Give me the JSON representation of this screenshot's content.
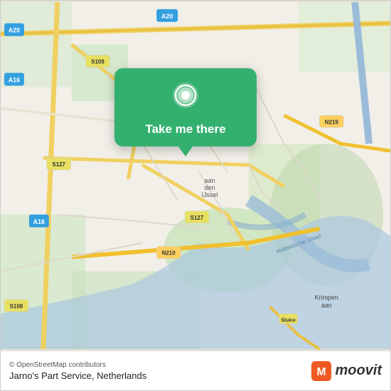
{
  "map": {
    "attribution": "© OpenStreetMap contributors",
    "location_name": "Jarno's Part Service, Netherlands",
    "accent_color": "#33b06e"
  },
  "popup": {
    "button_label": "Take me there",
    "pin_icon": "map-pin-icon"
  },
  "footer": {
    "attribution": "© OpenStreetMap contributors",
    "location_name": "Jarno's Part Service, Netherlands",
    "moovit_logo_text": "moovit"
  }
}
